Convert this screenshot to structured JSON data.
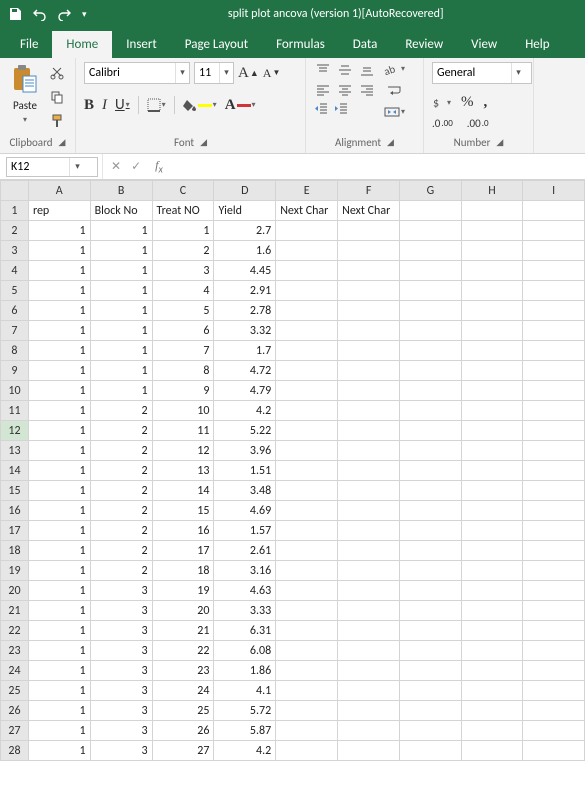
{
  "title": "split plot ancova (version 1)[AutoRecovered]",
  "tabs": {
    "file": "File",
    "home": "Home",
    "insert": "Insert",
    "page_layout": "Page Layout",
    "formulas": "Formulas",
    "data": "Data",
    "review": "Review",
    "view": "View",
    "help": "Help"
  },
  "ribbon": {
    "clipboard": {
      "paste": "Paste",
      "label": "Clipboard"
    },
    "font": {
      "name": "Calibri",
      "size": "11",
      "bold": "B",
      "italic": "I",
      "underline": "U",
      "grow": "A",
      "shrink": "A",
      "label": "Font"
    },
    "alignment": {
      "wrap": "ab",
      "label": "Alignment"
    },
    "number": {
      "format": "General",
      "label": "Number"
    }
  },
  "namebox": "K12",
  "formula": "",
  "columns": [
    "A",
    "B",
    "C",
    "D",
    "E",
    "F",
    "G",
    "H",
    "I"
  ],
  "headers": [
    "rep",
    "Block No",
    "Treat NO",
    "Yield",
    "Next Char",
    "Next Char",
    "",
    "",
    ""
  ],
  "rows": [
    {
      "n": 1
    },
    {
      "n": 2,
      "cells": [
        "1",
        "1",
        "1",
        "2.7"
      ]
    },
    {
      "n": 3,
      "cells": [
        "1",
        "1",
        "2",
        "1.6"
      ]
    },
    {
      "n": 4,
      "cells": [
        "1",
        "1",
        "3",
        "4.45"
      ]
    },
    {
      "n": 5,
      "cells": [
        "1",
        "1",
        "4",
        "2.91"
      ]
    },
    {
      "n": 6,
      "cells": [
        "1",
        "1",
        "5",
        "2.78"
      ]
    },
    {
      "n": 7,
      "cells": [
        "1",
        "1",
        "6",
        "3.32"
      ]
    },
    {
      "n": 8,
      "cells": [
        "1",
        "1",
        "7",
        "1.7"
      ]
    },
    {
      "n": 9,
      "cells": [
        "1",
        "1",
        "8",
        "4.72"
      ]
    },
    {
      "n": 10,
      "cells": [
        "1",
        "1",
        "9",
        "4.79"
      ]
    },
    {
      "n": 11,
      "cells": [
        "1",
        "2",
        "10",
        "4.2"
      ]
    },
    {
      "n": 12,
      "cells": [
        "1",
        "2",
        "11",
        "5.22"
      ],
      "sel": true
    },
    {
      "n": 13,
      "cells": [
        "1",
        "2",
        "12",
        "3.96"
      ]
    },
    {
      "n": 14,
      "cells": [
        "1",
        "2",
        "13",
        "1.51"
      ]
    },
    {
      "n": 15,
      "cells": [
        "1",
        "2",
        "14",
        "3.48"
      ]
    },
    {
      "n": 16,
      "cells": [
        "1",
        "2",
        "15",
        "4.69"
      ]
    },
    {
      "n": 17,
      "cells": [
        "1",
        "2",
        "16",
        "1.57"
      ]
    },
    {
      "n": 18,
      "cells": [
        "1",
        "2",
        "17",
        "2.61"
      ]
    },
    {
      "n": 19,
      "cells": [
        "1",
        "2",
        "18",
        "3.16"
      ]
    },
    {
      "n": 20,
      "cells": [
        "1",
        "3",
        "19",
        "4.63"
      ]
    },
    {
      "n": 21,
      "cells": [
        "1",
        "3",
        "20",
        "3.33"
      ]
    },
    {
      "n": 22,
      "cells": [
        "1",
        "3",
        "21",
        "6.31"
      ]
    },
    {
      "n": 23,
      "cells": [
        "1",
        "3",
        "22",
        "6.08"
      ]
    },
    {
      "n": 24,
      "cells": [
        "1",
        "3",
        "23",
        "1.86"
      ]
    },
    {
      "n": 25,
      "cells": [
        "1",
        "3",
        "24",
        "4.1"
      ]
    },
    {
      "n": 26,
      "cells": [
        "1",
        "3",
        "25",
        "5.72"
      ]
    },
    {
      "n": 27,
      "cells": [
        "1",
        "3",
        "26",
        "5.87"
      ]
    },
    {
      "n": 28,
      "cells": [
        "1",
        "3",
        "27",
        "4.2"
      ]
    }
  ],
  "chart_data": {
    "type": "table",
    "columns": [
      "rep",
      "Block No",
      "Treat NO",
      "Yield"
    ],
    "data": [
      [
        1,
        1,
        1,
        2.7
      ],
      [
        1,
        1,
        2,
        1.6
      ],
      [
        1,
        1,
        3,
        4.45
      ],
      [
        1,
        1,
        4,
        2.91
      ],
      [
        1,
        1,
        5,
        2.78
      ],
      [
        1,
        1,
        6,
        3.32
      ],
      [
        1,
        1,
        7,
        1.7
      ],
      [
        1,
        1,
        8,
        4.72
      ],
      [
        1,
        1,
        9,
        4.79
      ],
      [
        1,
        2,
        10,
        4.2
      ],
      [
        1,
        2,
        11,
        5.22
      ],
      [
        1,
        2,
        12,
        3.96
      ],
      [
        1,
        2,
        13,
        1.51
      ],
      [
        1,
        2,
        14,
        3.48
      ],
      [
        1,
        2,
        15,
        4.69
      ],
      [
        1,
        2,
        16,
        1.57
      ],
      [
        1,
        2,
        17,
        2.61
      ],
      [
        1,
        2,
        18,
        3.16
      ],
      [
        1,
        3,
        19,
        4.63
      ],
      [
        1,
        3,
        20,
        3.33
      ],
      [
        1,
        3,
        21,
        6.31
      ],
      [
        1,
        3,
        22,
        6.08
      ],
      [
        1,
        3,
        23,
        1.86
      ],
      [
        1,
        3,
        24,
        4.1
      ],
      [
        1,
        3,
        25,
        5.72
      ],
      [
        1,
        3,
        26,
        5.87
      ],
      [
        1,
        3,
        27,
        4.2
      ]
    ]
  }
}
